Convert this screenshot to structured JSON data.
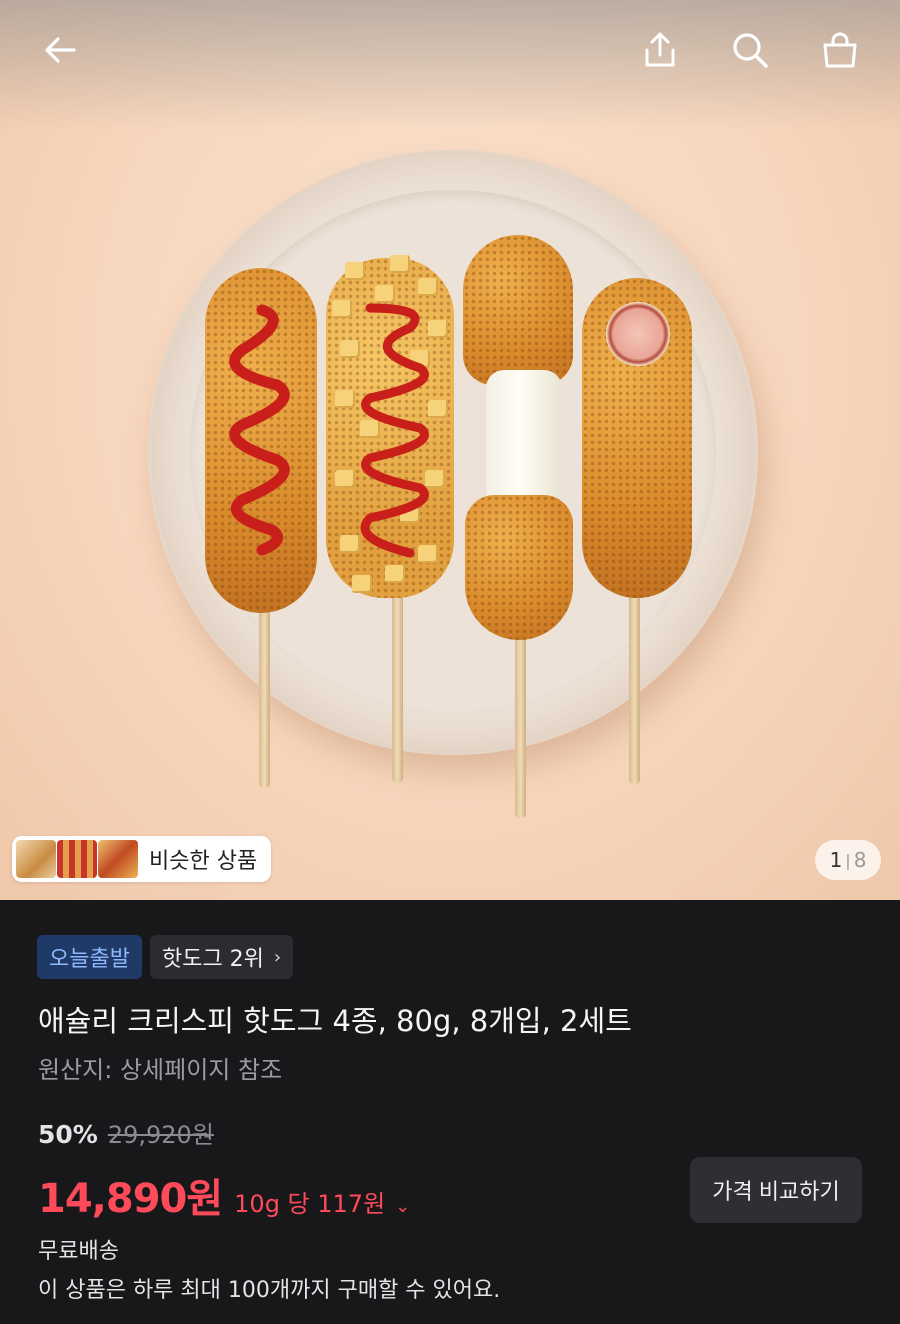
{
  "header": {
    "back_icon": "arrow-left-icon",
    "share_icon": "share-icon",
    "search_icon": "search-icon",
    "cart_icon": "shopping-bag-icon"
  },
  "gallery": {
    "similar_label": "비슷한 상품",
    "current_index": "1",
    "total_count": "8"
  },
  "product": {
    "badges": {
      "delivery": "오늘출발",
      "ranking": "핫도그 2위"
    },
    "title": "애슐리 크리스피 핫도그 4종, 80g, 8개입, 2세트",
    "origin": "원산지: 상세페이지 참조",
    "discount_rate": "50%",
    "original_price": "29,920원",
    "sale_price": "14,890원",
    "unit_price": "10g 당 117원",
    "compare_button": "가격 비교하기",
    "shipping": "무료배송",
    "purchase_limit": "이 상품은 하루 최대 100개까지 구매할 수 있어요."
  },
  "colors": {
    "price_red": "#ff4a5a",
    "badge_blue_text": "#8fb8ff",
    "panel_bg": "#18181b"
  }
}
